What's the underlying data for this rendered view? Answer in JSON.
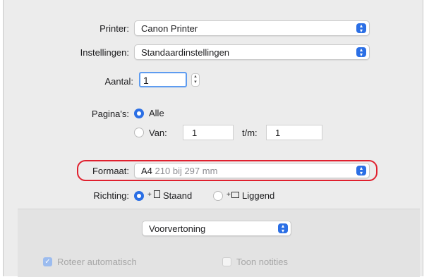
{
  "printer": {
    "label": "Printer:",
    "value": "Canon Printer",
    "icon": "popup-arrows-icon"
  },
  "settings": {
    "label": "Instellingen:",
    "value": "Standaardinstellingen",
    "icon": "popup-arrows-icon"
  },
  "copies": {
    "label": "Aantal:",
    "value": "1"
  },
  "pages": {
    "label": "Pagina's:",
    "all_label": "Alle",
    "range_label": "Van:",
    "range_from": "1",
    "to_label": "t/m:",
    "range_to": "1",
    "selected": "Alle"
  },
  "format": {
    "label": "Formaat:",
    "size_name": "A4",
    "size_detail": "210 bij 297 mm",
    "highlight_color": "#e0202e"
  },
  "orientation": {
    "label": "Richting:",
    "portrait_label": "Staand",
    "landscape_label": "Liggend",
    "selected": "Staand"
  },
  "preview": {
    "value": "Voorvertoning"
  },
  "options": {
    "auto_rotate_label": "Roteer automatisch",
    "auto_rotate_checked": true,
    "show_notes_label": "Toon notities",
    "show_notes_checked": false
  },
  "colors": {
    "accent": "#2b6fe5",
    "dialog_bg": "#ececec"
  }
}
